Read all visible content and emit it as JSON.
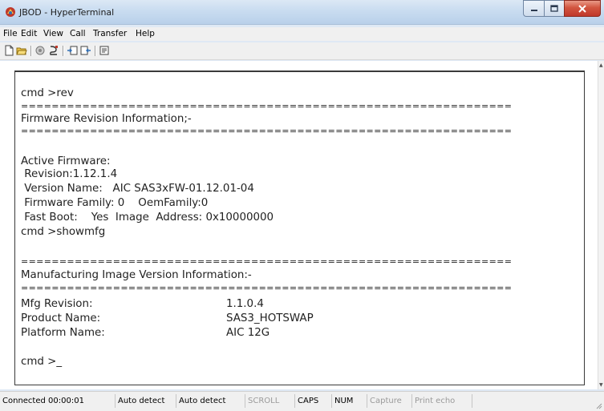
{
  "window": {
    "title": "JBOD - HyperTerminal"
  },
  "menu": [
    "File",
    "Edit",
    "View",
    "Call",
    "Transfer",
    "Help"
  ],
  "toolbar_icons": [
    "new-file-icon",
    "open-folder-icon",
    "call-icon",
    "disconnect-icon",
    "send-file-icon",
    "receive-file-icon",
    "properties-icon"
  ],
  "terminal": {
    "lines": [
      "cmd >rev",
      "================================================================",
      "Firmware Revision Information;-",
      "================================================================",
      "Active Firmware:",
      " Revision:1.12.1.4",
      " Version Name:   AIC SAS3xFW-01.12.01-04",
      " Firmware Family: 0    OemFamily:0",
      " Fast Boot:    Yes  Image  Address: 0x10000000",
      "cmd >showmfg",
      "================================================================",
      "Manufacturing Image Version Information:-",
      "================================================================",
      "Mfg Revision:",
      "1.1.0.4",
      "Product Name:",
      "SAS3_HOTSWAP",
      "Platform Name:",
      "AIC 12G",
      "cmd >_"
    ]
  },
  "status": {
    "connected": "Connected 00:00:01",
    "detect1": "Auto detect",
    "detect2": "Auto detect",
    "scroll": "SCROLL",
    "caps": "CAPS",
    "num": "NUM",
    "capture": "Capture",
    "print_echo": "Print echo"
  }
}
